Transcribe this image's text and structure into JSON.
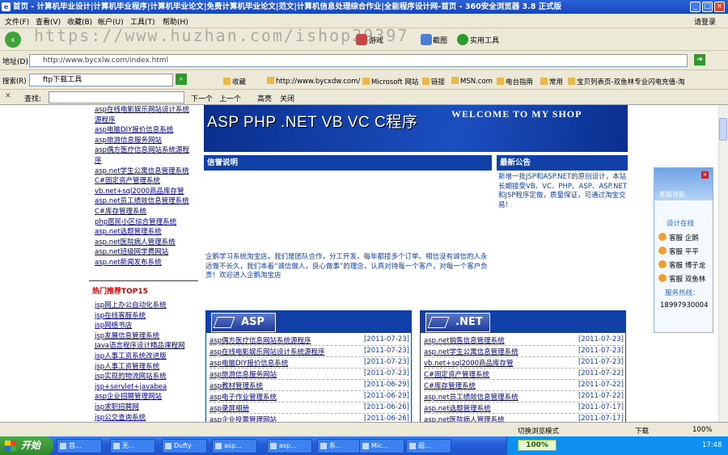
{
  "title_bar": {
    "text": "首页 - 计算机毕业设计|计算机毕业程序|计算机毕业论文|免费计算机毕业论文|范文|计算机信息处理综合作业|全能程序设计网-首页 - 360安全浏览器 3.8 正式版",
    "right": "请登录"
  },
  "menu": [
    "文件(F)",
    "查看(V)",
    "收藏(B)",
    "帐户(U)",
    "工具(T)",
    "帮助(H)"
  ],
  "toolbar": {
    "items": [
      "游戏",
      "截图",
      "实用工具"
    ],
    "watermark": "https://www.huzhan.com/ishop29397"
  },
  "address": {
    "label": "地址(D)",
    "url": "http://www.bycxlw.com/index.html"
  },
  "linksbar": {
    "label": "搜索(R)",
    "search_value": "ftp下载工具",
    "favorites": [
      "收藏",
      "http://www.bycxdw.com/",
      "Microsoft 网站",
      "链接",
      "MSN.com",
      "电台指南",
      "常用",
      "宝贝列表页-双鱼林专业闪电充值-淘"
    ]
  },
  "findbar": {
    "label": "查找:",
    "next": "下一个",
    "prev": "上一个",
    "highlight": "高亮",
    "close": "关闭"
  },
  "left_links_top": [
    "asp在线电影娱乐网站设计系统",
    "源程序",
    "asp电脑DIY报价信息系统",
    "asp旅游信息服务网站",
    "asp偶方医疗信息网站系统源程",
    "序",
    "asp.net学生公寓信息管理系统",
    "C#固定资产管理系统",
    "vb.net+sql2000商品库存管",
    "asp.net员工绩效信息管理系统",
    "C#库存管理系统",
    "php居民小区综合管理系统",
    "asp.net选题管理系统",
    "asp.net医院病人管理系统",
    "asp.net班级网学费网站",
    "asp.net新闻发布系统"
  ],
  "hot_title": "热门推荐TOP15",
  "left_links_hot": [
    "jsp网上办公自动化系统",
    "jsp在线客服系统",
    "jsp网络书店",
    "jsp发展信息管理系统",
    "Java语言程序设计精品课程网",
    "jsp人事工资系统改进版",
    "jsp人事工资管理系统",
    "jsp实现的物流网站系统",
    "jsp+servlet+javabea",
    "asp企业招聘管理网站",
    "jsp求职招聘网",
    "jsp公交查询系统"
  ],
  "banner": {
    "main": "ASP PHP .NET VB VC C程序",
    "sub": "WELCOME TO MY SHOP"
  },
  "credit": {
    "header": "信誉说明",
    "text": "企鹅学习系统淘宝店，我们是团队合作，分工开发，每年都接多个订单。相信没有诚信的人永远做不长久，我们本着“诚信做人，良心做事”的理念，认真对待每一个客户，对每一个客户负责！欢迎进入企鹅淘宝店"
  },
  "notice": {
    "header": "最新公告",
    "text": "新增一批JSP和ASP.NET的原创设计，本站长期接受VB、VC、PHP、ASP、ASP.NET和JSP程序定做，质量保证，可通过淘宝交易！"
  },
  "asp_section": {
    "badge": "ASP",
    "rows": [
      [
        "asp偶方医疗信息网站系统源程序",
        "[2011-07-23]"
      ],
      [
        "asp在线电影娱乐网站设计系统源程序",
        "[2011-07-23]"
      ],
      [
        "asp电脑DIY报价信息系统",
        "[2011-07-23]"
      ],
      [
        "asp旅游信息服务网站",
        "[2011-07-23]"
      ],
      [
        "asp教材管理系统",
        "[2011-06-29]"
      ],
      [
        "asp电子作业管理系统",
        "[2011-06-29]"
      ],
      [
        "asp录屏相册",
        "[2011-06-26]"
      ],
      [
        "asp企业投票管理网站",
        "[2011-06-26]"
      ]
    ]
  },
  "net_section": {
    "badge": ".NET",
    "rows": [
      [
        "asp.net销售信息管理系统",
        "[2011-07-23]"
      ],
      [
        "asp.net学生公寓信息管理系统",
        "[2011-07-23]"
      ],
      [
        "vb.net+sql2000商品库存管",
        "[2011-07-23]"
      ],
      [
        "C#固定资产管理系统",
        "[2011-07-22]"
      ],
      [
        "C#库存管理系统",
        "[2011-07-22]"
      ],
      [
        "asp.net员工绩效信息管理系统",
        "[2011-07-22]"
      ],
      [
        "asp.net选题管理系统",
        "[2011-07-17]"
      ],
      [
        "asp.net医院病人管理系统",
        "[2011-07-17]"
      ]
    ]
  },
  "qq": {
    "head": "客服导航",
    "online": "设计在线",
    "rows": [
      "客服 企鹅",
      "客服 平平",
      "客服 博子龙",
      "客服 双鱼林"
    ],
    "hotline_label": "服务热线：",
    "hotline": "18997930004"
  },
  "statusbar": {
    "switch": "切换浏览模式",
    "download": "下载",
    "zoom": "100%"
  },
  "taskbar": {
    "start": "开始",
    "tasks": [
      "首...",
      "无...",
      "Dufty",
      "asp...",
      "asp...",
      "系...",
      "Mic...",
      "超..."
    ],
    "tray_pct": "100%",
    "clock": "17:48"
  }
}
